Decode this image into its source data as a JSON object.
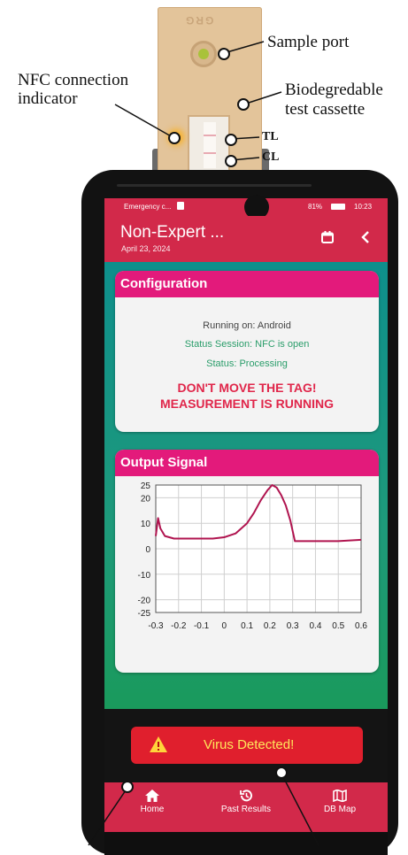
{
  "annotations": {
    "sample_port": "Sample port",
    "nfc_line1": "NFC connection",
    "nfc_line2": "indicator",
    "bio_line1": "Biodegredable",
    "bio_line2": "test cassette",
    "tl": "TL",
    "cl": "CL"
  },
  "cassette": {
    "logo": "GRG"
  },
  "status_bar": {
    "left": "Emergency c...",
    "right": "81%",
    "time": "10:23"
  },
  "app_bar": {
    "title": "Non-Expert ...",
    "date": "April 23, 2024",
    "calendar_icon": "calendar-icon",
    "back_icon": "chevron-left-icon"
  },
  "configuration": {
    "header": "Configuration",
    "running_on": "Running on: Android",
    "session": "Status Session: NFC is open",
    "status": "Status: Processing",
    "warning_line1": "DON'T MOVE THE TAG!",
    "warning_line2": "MEASUREMENT IS RUNNING"
  },
  "output_signal": {
    "header": "Output Signal"
  },
  "chart_data": {
    "type": "line",
    "x": [
      -0.3,
      -0.29,
      -0.28,
      -0.26,
      -0.22,
      -0.15,
      -0.05,
      0.0,
      0.05,
      0.1,
      0.13,
      0.16,
      0.19,
      0.21,
      0.23,
      0.25,
      0.27,
      0.29,
      0.31,
      0.33,
      0.4,
      0.5,
      0.6
    ],
    "values": [
      5,
      12,
      8,
      5,
      4,
      4,
      4,
      4.5,
      6,
      10,
      14,
      19,
      23,
      25,
      24,
      21,
      17,
      11,
      3,
      3,
      3,
      3,
      3.5
    ],
    "xticks": [
      "-0.3",
      "-0.2",
      "-0.1",
      "0",
      "0.1",
      "0.2",
      "0.3",
      "0.4",
      "0.5",
      "0.6"
    ],
    "xtick_values": [
      -0.3,
      -0.2,
      -0.1,
      0,
      0.1,
      0.2,
      0.3,
      0.4,
      0.5,
      0.6
    ],
    "yticks": [
      "25",
      "20",
      "10",
      "0",
      "-10",
      "-20",
      "-25"
    ],
    "ytick_values": [
      25,
      20,
      10,
      0,
      -10,
      -20,
      -25
    ],
    "xlim": [
      -0.3,
      0.6
    ],
    "ylim": [
      -25,
      25
    ],
    "grid": true,
    "line_color": "#b0144f"
  },
  "alert": {
    "icon": "warning-icon",
    "label": "Virus Detected!"
  },
  "bottom_nav": [
    {
      "label": "Home",
      "icon": "home-icon"
    },
    {
      "label": "Past Results",
      "icon": "history-icon"
    },
    {
      "label": "DB Map",
      "icon": "map-icon"
    }
  ],
  "colors": {
    "app_red": "#d2294a",
    "card_header": "#e31a7b",
    "status_green": "#2a9d6a",
    "warning_red": "#e0264a",
    "alert_text": "#ffe65b"
  }
}
